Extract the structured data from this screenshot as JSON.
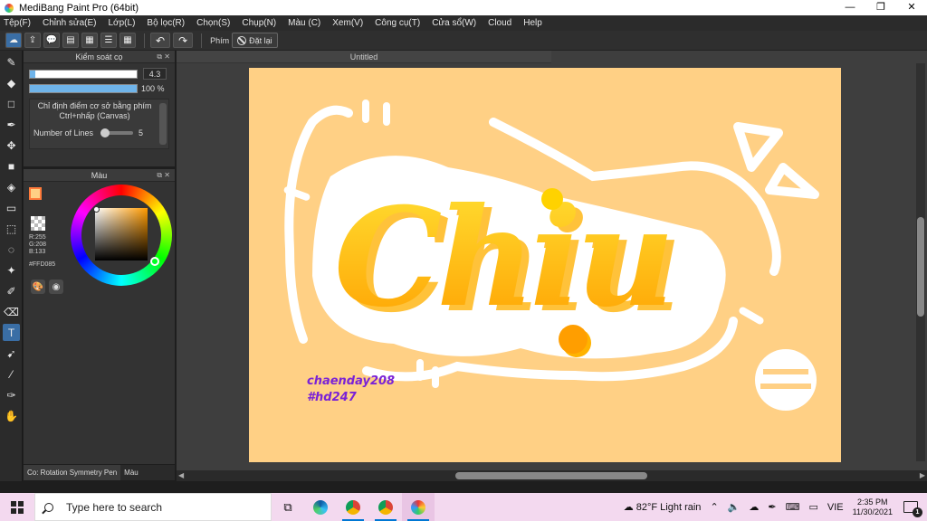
{
  "window": {
    "title": "MediBang Paint Pro (64bit)",
    "controls": [
      "—",
      "❐",
      "✕"
    ]
  },
  "menu": [
    "Tệp(F)",
    "Chỉnh sửa(E)",
    "Lớp(L)",
    "Bộ lọc(R)",
    "Chọn(S)",
    "Chụp(N)",
    "Màu (C)",
    "Xem(V)",
    "Công cụ(T)",
    "Cửa sổ(W)",
    "Cloud",
    "Help"
  ],
  "toolbar": {
    "snap_label": "Phím",
    "reset_label": "Đặt lại"
  },
  "brush_panel": {
    "title": "Kiểm soát cọ",
    "size_value": "4.3",
    "size_fraction": 0.05,
    "opacity_value": "100 %",
    "opacity_fraction": 1.0,
    "description": "Chỉ định điểm cơ sở bằng phím Ctrl+nhấp (Canvas)",
    "lines_label": "Number of Lines",
    "lines_value": "5"
  },
  "color_panel": {
    "title": "Màu",
    "foreground": "#FFD085",
    "rgb": "R:255\nG:208\nB:133",
    "hex": "#FFD085"
  },
  "panel_tabs": [
    "Co: Rotation Symmetry Pen",
    "Màu"
  ],
  "canvas": {
    "doc_title": "Untitled",
    "background": "#FFD085",
    "lettering": "Chiu",
    "signature_1": "chaenday208",
    "signature_2": "#hd247"
  },
  "taskbar": {
    "search_placeholder": "Type here to search",
    "weather": "82°F  Light rain",
    "lang": "VIE",
    "time": "2:35 PM",
    "date": "11/30/2021",
    "notif_count": "1"
  }
}
